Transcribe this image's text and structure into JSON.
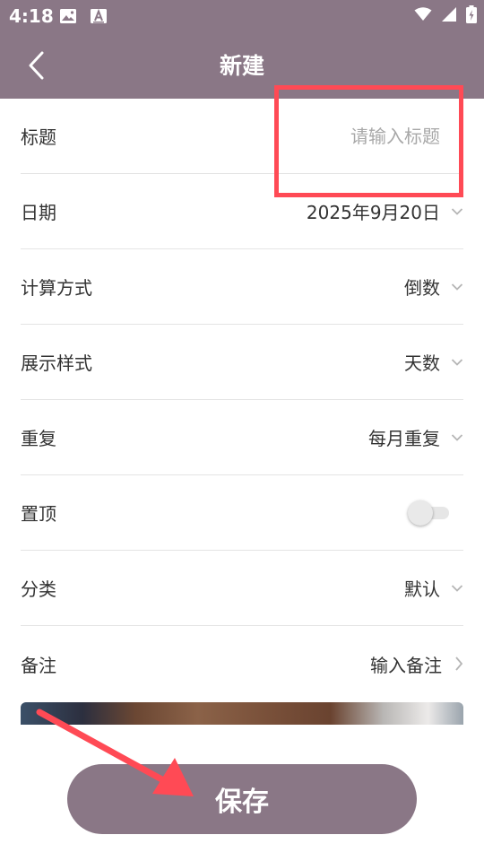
{
  "status_bar": {
    "time": "4:18"
  },
  "header": {
    "title": "新建"
  },
  "form": {
    "title_label": "标题",
    "title_placeholder": "请输入标题",
    "date_label": "日期",
    "date_value": "2025年9月20日",
    "calc_label": "计算方式",
    "calc_value": "倒数",
    "display_label": "展示样式",
    "display_value": "天数",
    "repeat_label": "重复",
    "repeat_value": "每月重复",
    "pin_label": "置顶",
    "pin_on": false,
    "category_label": "分类",
    "category_value": "默认",
    "note_label": "备注",
    "note_value": "输入备注"
  },
  "save_button": {
    "label": "保存"
  },
  "colors": {
    "header_bg": "#8a7786",
    "button_bg": "#8a7786",
    "annotation_red": "#ff4a55"
  }
}
